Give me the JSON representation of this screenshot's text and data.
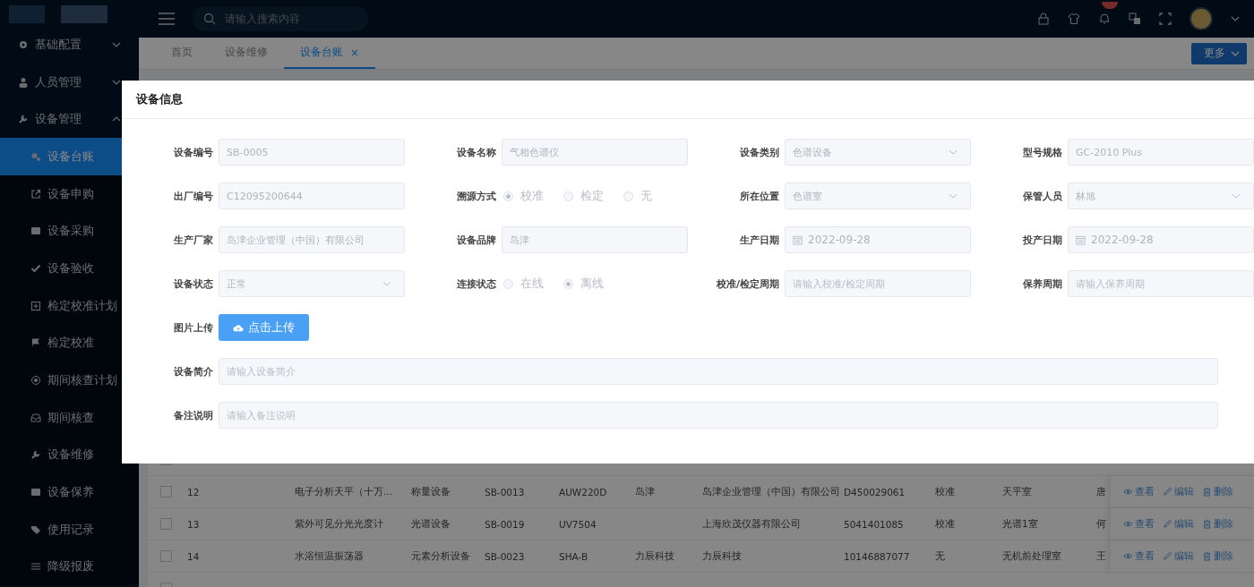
{
  "sidebar": {
    "items": [
      {
        "label": "基础配置",
        "expanded": false
      },
      {
        "label": "人员管理",
        "expanded": false
      },
      {
        "label": "设备管理",
        "expanded": true,
        "children": [
          {
            "label": "设备台账",
            "selected": true
          },
          {
            "label": "设备申购",
            "selected": false
          },
          {
            "label": "设备采购",
            "selected": false
          },
          {
            "label": "设备验收",
            "selected": false
          },
          {
            "label": "检定校准计划",
            "selected": false
          },
          {
            "label": "检定校准",
            "selected": false
          },
          {
            "label": "期间核查计划",
            "selected": false
          },
          {
            "label": "期间核查",
            "selected": false
          },
          {
            "label": "设备维修",
            "selected": false
          },
          {
            "label": "设备保养",
            "selected": false
          },
          {
            "label": "使用记录",
            "selected": false
          },
          {
            "label": "降级报废",
            "selected": false
          }
        ]
      }
    ]
  },
  "topbar": {
    "search": {
      "placeholder": "请输入搜索内容"
    }
  },
  "tabs": [
    {
      "label": "首页",
      "selected": false,
      "closable": false
    },
    {
      "label": "设备维修",
      "selected": false,
      "closable": false
    },
    {
      "label": "设备台账",
      "selected": true,
      "closable": true
    }
  ],
  "tabs_close": "×",
  "more_button": "更多",
  "table": {
    "rows": [
      {
        "checked": false,
        "cells": []
      },
      {
        "checked": false,
        "cells": [
          "12",
          "",
          "电子分析天平（十万...",
          "称量设备",
          "SB-0013",
          "AUW220D",
          "岛津",
          "岛津企业管理（中国）有限公司",
          "D450029061",
          "校准",
          "天平室",
          "唐"
        ],
        "actions": [
          "查看",
          "编辑",
          "删除"
        ]
      },
      {
        "checked": false,
        "cells": [
          "13",
          "",
          "紫外可见分光光度计",
          "光谱设备",
          "SB-0019",
          "UV7504",
          "",
          "上海欣茂仪器有限公司",
          "5041401085",
          "校准",
          "光谱1室",
          "何"
        ],
        "actions": [
          "查看",
          "编辑",
          "删除"
        ]
      },
      {
        "checked": false,
        "cells": [
          "14",
          "",
          "水浴恒温振荡器",
          "元素分析设备",
          "SB-0023",
          "SHA-B",
          "力辰科技",
          "力辰科技",
          "10146887077",
          "无",
          "无机前处理室",
          "王"
        ],
        "actions": [
          "查看",
          "编辑",
          "删除"
        ]
      },
      {
        "checked": false,
        "cells": []
      }
    ]
  },
  "dialog": {
    "title": "设备信息",
    "rows": [
      [
        {
          "label": "设备编号",
          "kind": "input",
          "value": "SB-0005"
        },
        {
          "label": "设备名称",
          "kind": "input",
          "value": "气相色谱仪"
        },
        {
          "label": "设备类别",
          "kind": "select",
          "value": "色谱设备"
        },
        {
          "label": "型号规格",
          "kind": "input",
          "value": "GC-2010 Plus"
        }
      ],
      [
        {
          "label": "出厂编号",
          "kind": "input",
          "value": "C12095200644"
        },
        {
          "label": "溯源方式",
          "kind": "radio",
          "options": [
            {
              "label": "校准",
              "selected": true
            },
            {
              "label": "检定",
              "selected": false
            },
            {
              "label": "无",
              "selected": false
            }
          ]
        },
        {
          "label": "所在位置",
          "kind": "select",
          "value": "色谱室"
        },
        {
          "label": "保管人员",
          "kind": "select",
          "value": "林旭"
        }
      ],
      [
        {
          "label": "生产厂家",
          "kind": "input",
          "value": "岛津企业管理（中国）有限公司"
        },
        {
          "label": "设备品牌",
          "kind": "input",
          "value": "岛津"
        },
        {
          "label": "生产日期",
          "kind": "date",
          "value": "2022-09-28"
        },
        {
          "label": "投产日期",
          "kind": "date",
          "value": "2022-09-28"
        }
      ],
      [
        {
          "label": "设备状态",
          "kind": "select",
          "value": "正常"
        },
        {
          "label": "连接状态",
          "kind": "radio",
          "options": [
            {
              "label": "在线",
              "selected": false
            },
            {
              "label": "离线",
              "selected": true
            }
          ]
        },
        {
          "label": "校准/检定周期",
          "kind": "input",
          "placeholder": "请输入校准/检定周期"
        },
        {
          "label": "保养周期",
          "kind": "input",
          "placeholder": "请输入保养周期"
        }
      ],
      [
        {
          "label": "图片上传",
          "kind": "upload",
          "value": "点击上传"
        }
      ],
      [
        {
          "label": "设备简介",
          "kind": "wide",
          "placeholder": "请输入设备简介"
        }
      ],
      [
        {
          "label": "备注说明",
          "kind": "wide",
          "placeholder": "请输入备注说明"
        }
      ]
    ]
  }
}
